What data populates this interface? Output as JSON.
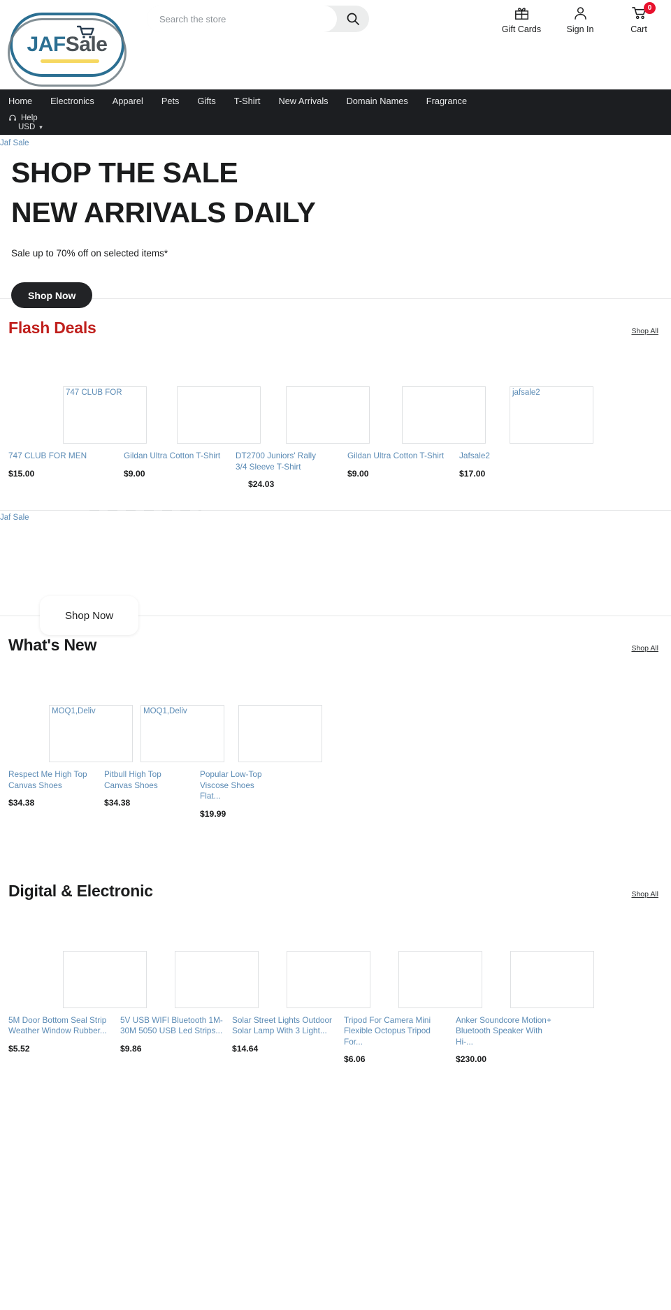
{
  "brand": {
    "logo_jaf": "JAF",
    "logo_sale": "Sale",
    "cart_icon": "cart-icon"
  },
  "search": {
    "placeholder": "Search the store",
    "value": "",
    "icon": "search-icon"
  },
  "header_actions": [
    {
      "label": "Gift Cards",
      "icon": "gift-icon"
    },
    {
      "label": "Sign In",
      "icon": "user-icon"
    },
    {
      "label": "Cart",
      "icon": "cart-icon",
      "badge": "0"
    }
  ],
  "nav": {
    "items": [
      "Home",
      "Electronics",
      "Apparel",
      "Pets",
      "Gifts",
      "T-Shirt",
      "New Arrivals",
      "Domain Names",
      "Fragrance"
    ],
    "help_label": "Help",
    "help_icon": "headset-icon",
    "currency_label": "USD",
    "currency_caret": "▾"
  },
  "hero": {
    "image_alt": "Jaf Sale",
    "title_line1": "SHOP THE SALE",
    "title_line2": "NEW ARRIVALS DAILY",
    "subtitle": "Sale up to 70% off on selected items*",
    "cta": "Shop Now"
  },
  "sections": [
    {
      "title": "Flash Deals",
      "shop_all": "Shop All",
      "accent": "#c0201d",
      "products": [
        {
          "image_alt": "747 CLUB FOR",
          "name": "747 CLUB FOR MEN",
          "price": "$15.00"
        },
        {
          "image_alt": "",
          "name": "Gildan Ultra Cotton T-Shirt",
          "price": "$9.00"
        },
        {
          "image_alt": "",
          "name": "DT2700 Juniors' Rally 3/4 Sleeve T-Shirt",
          "price": "$24.03"
        },
        {
          "image_alt": "",
          "name": "Gildan Ultra Cotton T-Shirt",
          "price": "$9.00"
        },
        {
          "image_alt": "jafsale2",
          "name": "Jafsale2",
          "price": "$17.00"
        }
      ]
    },
    {
      "title": "What's New",
      "shop_all": "Shop All",
      "accent": "#1b1c1d",
      "products": [
        {
          "image_alt": "MOQ1,Deliv",
          "name": "Respect Me High Top Canvas Shoes",
          "price": "$34.38"
        },
        {
          "image_alt": "MOQ1,Deliv",
          "name": "Pitbull High Top Canvas Shoes",
          "price": "$34.38"
        },
        {
          "image_alt": "",
          "name": "Popular Low-Top Viscose Shoes Flat...",
          "price": "$19.99"
        }
      ]
    },
    {
      "title": "Digital & Electronic",
      "shop_all": "Shop All",
      "accent": "#1b1c1d",
      "products": [
        {
          "image_alt": "",
          "name": "5M Door Bottom Seal Strip Weather Window Rubber...",
          "price": "$5.52"
        },
        {
          "image_alt": "",
          "name": "5V USB WIFI Bluetooth 1M-30M 5050 USB Led Strips...",
          "price": "$9.86"
        },
        {
          "image_alt": "",
          "name": "Solar Street Lights Outdoor Solar Lamp With 3 Light...",
          "price": "$14.64"
        },
        {
          "image_alt": "",
          "name": "Tripod For Camera Mini Flexible Octopus Tripod For...",
          "price": "$6.06"
        },
        {
          "image_alt": "",
          "name": "Anker Soundcore Motion+ Bluetooth Speaker With Hi-...",
          "price": "$230.00"
        }
      ]
    }
  ],
  "mid_banner": {
    "image_alt": "Jaf Sale",
    "cta": "Shop Now"
  },
  "colors": {
    "nav_bg": "#1c1e21",
    "flash_red": "#c0201d",
    "link_blue": "#5b8bb5",
    "badge_red": "#e8112d",
    "logo_blue": "#2b6f92",
    "logo_yellow": "#f6d860"
  }
}
